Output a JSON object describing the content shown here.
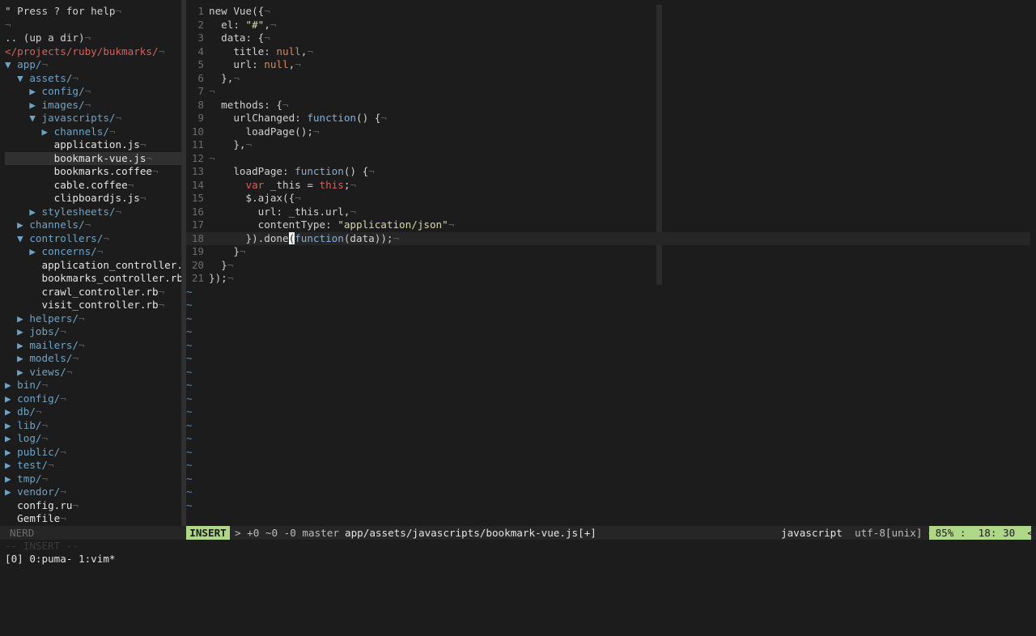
{
  "tree": {
    "help": "\" Press ? for help",
    "up_dir": ".. (up a dir)",
    "cwd": "</projects/ruby/bukmarks/",
    "items": [
      {
        "indent": 0,
        "arrow": "▼",
        "label": "app/"
      },
      {
        "indent": 1,
        "arrow": "▼",
        "label": "assets/"
      },
      {
        "indent": 2,
        "arrow": "▶",
        "label": "config/"
      },
      {
        "indent": 2,
        "arrow": "▶",
        "label": "images/"
      },
      {
        "indent": 2,
        "arrow": "▼",
        "label": "javascripts/"
      },
      {
        "indent": 3,
        "arrow": "▶",
        "label": "channels/"
      },
      {
        "indent": 3,
        "arrow": "",
        "label": "application.js"
      },
      {
        "indent": 3,
        "arrow": "",
        "label": "bookmark-vue.js",
        "selected": true
      },
      {
        "indent": 3,
        "arrow": "",
        "label": "bookmarks.coffee"
      },
      {
        "indent": 3,
        "arrow": "",
        "label": "cable.coffee"
      },
      {
        "indent": 3,
        "arrow": "",
        "label": "clipboardjs.js"
      },
      {
        "indent": 2,
        "arrow": "▶",
        "label": "stylesheets/"
      },
      {
        "indent": 1,
        "arrow": "▶",
        "label": "channels/"
      },
      {
        "indent": 1,
        "arrow": "▼",
        "label": "controllers/"
      },
      {
        "indent": 2,
        "arrow": "▶",
        "label": "concerns/"
      },
      {
        "indent": 2,
        "arrow": "",
        "label": "application_controller.rb"
      },
      {
        "indent": 2,
        "arrow": "",
        "label": "bookmarks_controller.rb"
      },
      {
        "indent": 2,
        "arrow": "",
        "label": "crawl_controller.rb"
      },
      {
        "indent": 2,
        "arrow": "",
        "label": "visit_controller.rb"
      },
      {
        "indent": 1,
        "arrow": "▶",
        "label": "helpers/"
      },
      {
        "indent": 1,
        "arrow": "▶",
        "label": "jobs/"
      },
      {
        "indent": 1,
        "arrow": "▶",
        "label": "mailers/"
      },
      {
        "indent": 1,
        "arrow": "▶",
        "label": "models/"
      },
      {
        "indent": 1,
        "arrow": "▶",
        "label": "views/"
      },
      {
        "indent": 0,
        "arrow": "▶",
        "label": "bin/"
      },
      {
        "indent": 0,
        "arrow": "▶",
        "label": "config/"
      },
      {
        "indent": 0,
        "arrow": "▶",
        "label": "db/"
      },
      {
        "indent": 0,
        "arrow": "▶",
        "label": "lib/"
      },
      {
        "indent": 0,
        "arrow": "▶",
        "label": "log/"
      },
      {
        "indent": 0,
        "arrow": "▶",
        "label": "public/"
      },
      {
        "indent": 0,
        "arrow": "▶",
        "label": "test/"
      },
      {
        "indent": 0,
        "arrow": "▶",
        "label": "tmp/"
      },
      {
        "indent": 0,
        "arrow": "▶",
        "label": "vendor/"
      },
      {
        "indent": 0,
        "arrow": "",
        "label": "config.ru"
      },
      {
        "indent": 0,
        "arrow": "",
        "label": "Gemfile"
      }
    ]
  },
  "editor": {
    "cursor_line": 18,
    "lines": [
      [
        [
          "",
          "new Vue({"
        ]
      ],
      [
        [
          "",
          "  el: "
        ],
        [
          "str",
          "\"#\""
        ],
        [
          "",
          ","
        ]
      ],
      [
        [
          "",
          "  data: {"
        ]
      ],
      [
        [
          "",
          "    title: "
        ],
        [
          "nul",
          "null"
        ],
        [
          "",
          ","
        ]
      ],
      [
        [
          "",
          "    url: "
        ],
        [
          "nul",
          "null"
        ],
        [
          "",
          ","
        ]
      ],
      [
        [
          "",
          "  },"
        ]
      ],
      [
        [
          "",
          ""
        ]
      ],
      [
        [
          "",
          "  methods: {"
        ]
      ],
      [
        [
          "",
          "    urlChanged: "
        ],
        [
          "fn",
          "function"
        ],
        [
          "",
          "() {"
        ]
      ],
      [
        [
          "",
          "      loadPage();"
        ]
      ],
      [
        [
          "",
          "    },"
        ]
      ],
      [
        [
          "",
          ""
        ]
      ],
      [
        [
          "",
          "    loadPage: "
        ],
        [
          "fn",
          "function"
        ],
        [
          "",
          "() {"
        ]
      ],
      [
        [
          "",
          "      "
        ],
        [
          "kw",
          "var"
        ],
        [
          "",
          " _this = "
        ],
        [
          "kw",
          "this"
        ],
        [
          "",
          ";"
        ]
      ],
      [
        [
          "",
          "      $.ajax({"
        ]
      ],
      [
        [
          "",
          "        url: _this.url,"
        ]
      ],
      [
        [
          "",
          "        contentType: "
        ],
        [
          "str",
          "\"application/json\""
        ]
      ],
      [
        [
          "",
          "      }).done"
        ],
        [
          "cursor",
          "("
        ],
        [
          "fn",
          "function"
        ],
        [
          "",
          "(data));"
        ]
      ],
      [
        [
          "",
          "    }"
        ]
      ],
      [
        [
          "",
          "  }"
        ]
      ],
      [
        [
          "",
          "});"
        ]
      ]
    ],
    "tilde_count": 17
  },
  "status": {
    "nerd_label": "NERD",
    "mode": "INSERT",
    "branch": "> +0 ~0 -0 master",
    "filepath": "app/assets/javascripts/bookmark-vue.js[+]",
    "filetype": "javascript",
    "encoding": "utf-8[unix] <",
    "position": " 85% :  18: 30  <"
  },
  "mode_line": "-- INSERT --",
  "tmux": "[0] 0:puma- 1:vim*"
}
